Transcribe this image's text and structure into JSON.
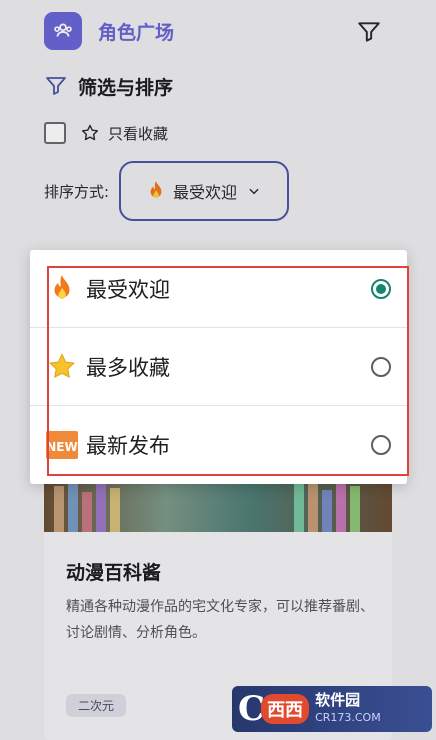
{
  "header": {
    "title": "角色广场",
    "logo_icon": "people-group-icon",
    "filter_icon": "filter-funnel-icon",
    "accent": "#6a68d8"
  },
  "filters": {
    "section_title": "筛选与排序",
    "favorites_only_label": "只看收藏",
    "favorites_only_checked": false,
    "sort_label": "排序方式:",
    "sort_selected": "最受欢迎",
    "sort_selected_icon": "fire-emoji"
  },
  "dropdown": {
    "options": [
      {
        "label": "最受欢迎",
        "icon": "fire-emoji",
        "selected": true
      },
      {
        "label": "最多收藏",
        "icon": "star-emoji",
        "selected": false
      },
      {
        "label": "最新发布",
        "icon": "new-emoji",
        "selected": false
      }
    ],
    "radio_color": "#14846e",
    "highlight_color": "#e0423d"
  },
  "card": {
    "title": "动漫百科酱",
    "description": "精通各种动漫作品的宅文化专家，可以推荐番剧、讨论剧情、分析角色。",
    "tag": "二次元"
  },
  "watermark": {
    "letter": "C",
    "badge": "西西",
    "name": "软件园",
    "domain": "CR173.COM"
  }
}
